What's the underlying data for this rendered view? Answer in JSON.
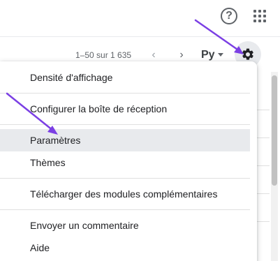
{
  "header": {
    "help_icon_glyph": "?",
    "help_icon": "help-circle-icon",
    "apps_icon": "apps-grid-icon"
  },
  "toolbar": {
    "pager_text": "1–50 sur 1 635",
    "prev_glyph": "‹",
    "next_glyph": "›",
    "language_label": "Рy",
    "settings_icon": "gear-icon"
  },
  "settings_menu": {
    "items": [
      {
        "label": "Densité d'affichage"
      },
      {
        "label": "Configurer la boîte de réception"
      },
      {
        "label": "Paramètres",
        "highlighted": true
      },
      {
        "label": "Thèmes"
      },
      {
        "label": "Télécharger des modules complémentaires"
      },
      {
        "label": "Envoyer un commentaire"
      },
      {
        "label": "Aide"
      }
    ]
  },
  "colors": {
    "arrow": "#7b3fe4",
    "hover_bg": "#e8eaed",
    "icon_gray": "#5f6368"
  }
}
